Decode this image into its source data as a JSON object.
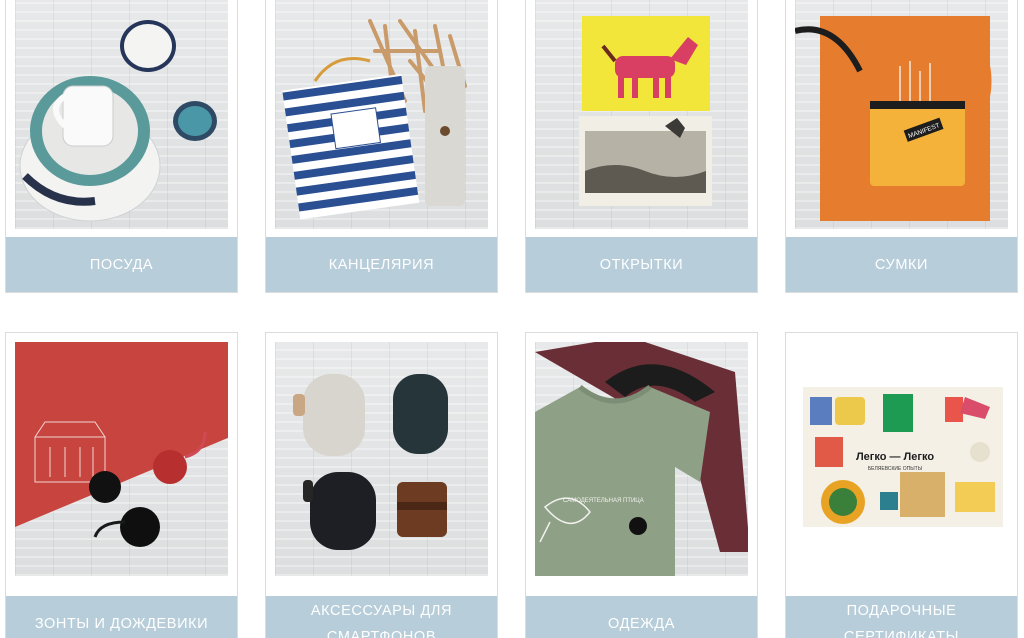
{
  "categories": [
    {
      "label": "ПОСУДА",
      "icon": "tableware-photo"
    },
    {
      "label": "КАНЦЕЛЯРИЯ",
      "icon": "stationery-photo"
    },
    {
      "label": "ОТКРЫТКИ",
      "icon": "postcards-photo"
    },
    {
      "label": "СУМКИ",
      "icon": "bags-photo"
    },
    {
      "label": "ЗОНТЫ И ДОЖДЕВИКИ",
      "icon": "umbrellas-photo"
    },
    {
      "label": "АКСЕССУАРЫ ДЛЯ СМАРТФОНОВ",
      "icon": "phone-accessories-photo"
    },
    {
      "label": "ОДЕЖДА",
      "icon": "clothing-photo"
    },
    {
      "label": "ПОДАРОЧНЫЕ СЕРТИФИКАТЫ",
      "icon": "gift-certificates-photo"
    }
  ],
  "photo_text": {
    "bag_tag": "MANIFEST",
    "certificate_title": "Легко — Легко",
    "certificate_subtitle": "БЕЛЯЕВСКИЕ ОПЫТЫ",
    "tshirt_print": "САМОДЕЯТЕЛЬНАЯ ПТИЦА"
  },
  "colors": {
    "label_bg": "#b7cdd9",
    "label_text": "#ffffff",
    "card_border": "#d9dde0"
  }
}
